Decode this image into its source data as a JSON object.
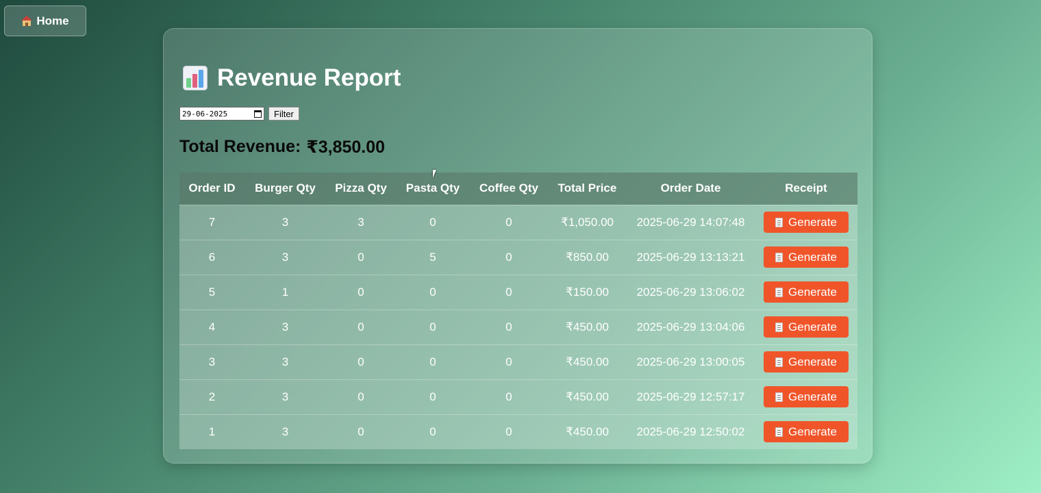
{
  "home_button": {
    "label": "Home",
    "icon": "home-icon"
  },
  "report": {
    "title": "Revenue Report",
    "title_icon": "bar-chart-icon",
    "filter": {
      "date_value": "29-06-2025",
      "button_label": "Filter"
    },
    "total_label": "Total Revenue:",
    "total_value": "₹3,850.00"
  },
  "table": {
    "headers": [
      "Order ID",
      "Burger Qty",
      "Pizza Qty",
      "Pasta Qty",
      "Coffee Qty",
      "Total Price",
      "Order Date",
      "Receipt"
    ],
    "rows": [
      {
        "order_id": "7",
        "burger": "3",
        "pizza": "3",
        "pasta": "0",
        "coffee": "0",
        "total": "₹1,050.00",
        "date": "2025-06-29 14:07:48",
        "receipt": "Generate"
      },
      {
        "order_id": "6",
        "burger": "3",
        "pizza": "0",
        "pasta": "5",
        "coffee": "0",
        "total": "₹850.00",
        "date": "2025-06-29 13:13:21",
        "receipt": "Generate"
      },
      {
        "order_id": "5",
        "burger": "1",
        "pizza": "0",
        "pasta": "0",
        "coffee": "0",
        "total": "₹150.00",
        "date": "2025-06-29 13:06:02",
        "receipt": "Generate"
      },
      {
        "order_id": "4",
        "burger": "3",
        "pizza": "0",
        "pasta": "0",
        "coffee": "0",
        "total": "₹450.00",
        "date": "2025-06-29 13:04:06",
        "receipt": "Generate"
      },
      {
        "order_id": "3",
        "burger": "3",
        "pizza": "0",
        "pasta": "0",
        "coffee": "0",
        "total": "₹450.00",
        "date": "2025-06-29 13:00:05",
        "receipt": "Generate"
      },
      {
        "order_id": "2",
        "burger": "3",
        "pizza": "0",
        "pasta": "0",
        "coffee": "0",
        "total": "₹450.00",
        "date": "2025-06-29 12:57:17",
        "receipt": "Generate"
      },
      {
        "order_id": "1",
        "burger": "3",
        "pizza": "0",
        "pasta": "0",
        "coffee": "0",
        "total": "₹450.00",
        "date": "2025-06-29 12:50:02",
        "receipt": "Generate"
      }
    ]
  },
  "colors": {
    "accent_button": "#f0552a",
    "background_start": "#1f4a3d",
    "background_end": "#9ff0c6"
  }
}
